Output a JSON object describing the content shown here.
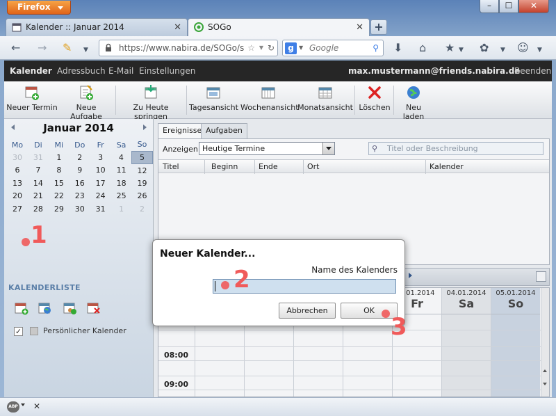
{
  "browser": {
    "menu_label": "Firefox",
    "min": "–",
    "max": "☐",
    "close": "✕",
    "tabs": [
      {
        "title": "Kalender :: Januar 2014",
        "close": "✕"
      },
      {
        "title": "SOGo",
        "close": "✕"
      }
    ],
    "new_tab": "+",
    "url": "https://www.nabira.de/SOGo/s",
    "search_engine": "g",
    "search_placeholder": "Google"
  },
  "menubar": {
    "items": [
      "Kalender",
      "Adressbuch",
      "E-Mail",
      "Einstellungen"
    ],
    "user": "max.mustermann@friends.nabira.de",
    "logout": "Beenden"
  },
  "toolbar": {
    "buttons": [
      "Neuer Termin",
      "Neue Aufgabe",
      "Zu Heute springen",
      "Tagesansicht",
      "Wochenansicht",
      "Monatsansicht",
      "Löschen",
      "Neu laden"
    ]
  },
  "minical": {
    "month": "Januar",
    "year": "2014",
    "weekdays": [
      "Mo",
      "Di",
      "Mi",
      "Do",
      "Fr",
      "Sa",
      "So"
    ],
    "weeks": [
      [
        "30",
        "31",
        "1",
        "2",
        "3",
        "4",
        "5"
      ],
      [
        "6",
        "7",
        "8",
        "9",
        "10",
        "11",
        "12"
      ],
      [
        "13",
        "14",
        "15",
        "16",
        "17",
        "18",
        "19"
      ],
      [
        "20",
        "21",
        "22",
        "23",
        "24",
        "25",
        "26"
      ],
      [
        "27",
        "28",
        "29",
        "30",
        "31",
        "1",
        "2"
      ]
    ]
  },
  "calendars": {
    "title": "KALENDERLISTE",
    "items": [
      {
        "name": "Persönlicher Kalender",
        "checked": "✓"
      }
    ]
  },
  "events": {
    "tabs": [
      "Ereignisse",
      "Aufgaben"
    ],
    "show_label": "Anzeigen:",
    "show_value": "Heutige Termine",
    "filter_placeholder": "Titel oder Beschreibung",
    "columns": [
      "Titel",
      "Beginn",
      "Ende",
      "Ort",
      "Kalender"
    ]
  },
  "week": {
    "days": [
      {
        "date": "3.01.2014",
        "name": "Fr"
      },
      {
        "date": "04.01.2014",
        "name": "Sa"
      },
      {
        "date": "05.01.2014",
        "name": "So"
      }
    ],
    "hours": [
      "08:00",
      "09:00"
    ]
  },
  "dialog": {
    "title": "Neuer Kalender...",
    "label": "Name des Kalenders",
    "value": "",
    "cancel": "Abbrechen",
    "ok": "OK"
  },
  "annotations": [
    "1",
    "2",
    "3"
  ],
  "status": {
    "adblock": "ABP",
    "close": "✕"
  },
  "colors": {
    "accent_red": "#f05a5a",
    "menubar_bg": "#262626",
    "firefox_orange": "#e0641a"
  }
}
